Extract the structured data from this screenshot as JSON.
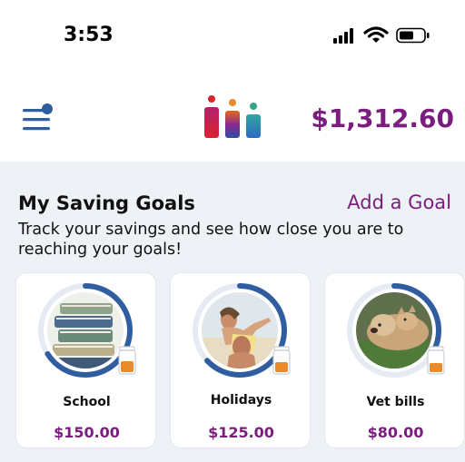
{
  "status_bar": {
    "time": "3:53",
    "icons": [
      "cellular-signal-icon",
      "wifi-icon",
      "battery-icon"
    ]
  },
  "header": {
    "menu_icon": "hamburger-menu-icon",
    "logo": "jars-logo",
    "balance": "$1,312.60"
  },
  "goals_section": {
    "title": "My Saving Goals",
    "add_label": "Add a Goal",
    "description": "Track your savings and see how close you are to reaching your goals!",
    "goals": [
      {
        "name": "School",
        "amount": "$150.00",
        "progress": 0.66,
        "image": "stack-of-books",
        "icon": "jar-icon"
      },
      {
        "name": "Holidays",
        "amount": "$125.00",
        "progress": 0.63,
        "image": "couple-on-beach",
        "icon": "jar-icon"
      },
      {
        "name": "Vet bills",
        "amount": "$80.00",
        "progress": 0.35,
        "image": "dog-and-cat",
        "icon": "jar-icon"
      }
    ]
  },
  "colors": {
    "brand_purple": "#7b1d7e",
    "progress_blue": "#2f5d9f",
    "progress_track": "#e6ebf3",
    "jar_orange": "#e98a2d",
    "background": "#eef1f6"
  }
}
